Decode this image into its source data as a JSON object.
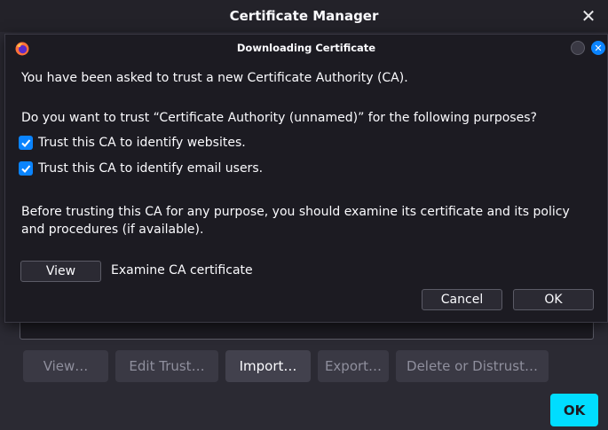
{
  "parent": {
    "title": "Certificate Manager",
    "buttons": [
      {
        "label": "View…",
        "enabled": false
      },
      {
        "label": "Edit Trust…",
        "enabled": false
      },
      {
        "label": "Import…",
        "enabled": true
      },
      {
        "label": "Export…",
        "enabled": false
      },
      {
        "label": "Delete or Distrust…",
        "enabled": false
      }
    ],
    "ok_label": "OK"
  },
  "dialog": {
    "title": "Downloading Certificate",
    "intro": "You have been asked to trust a new Certificate Authority (CA).",
    "question": "Do you want to trust “Certificate Authority (unnamed)” for the following purposes?",
    "checkboxes": [
      {
        "label": "Trust this CA to identify websites.",
        "checked": true
      },
      {
        "label": "Trust this CA to identify email users.",
        "checked": true
      }
    ],
    "advice": "Before trusting this CA for any purpose, you should examine its certificate and its policy and procedures (if available).",
    "view_label": "View",
    "examine_label": "Examine CA certificate",
    "cancel_label": "Cancel",
    "ok_label": "OK"
  },
  "colors": {
    "accent": "#0a84ff",
    "primary_button": "#00ddff",
    "background": "#1c1b22"
  }
}
